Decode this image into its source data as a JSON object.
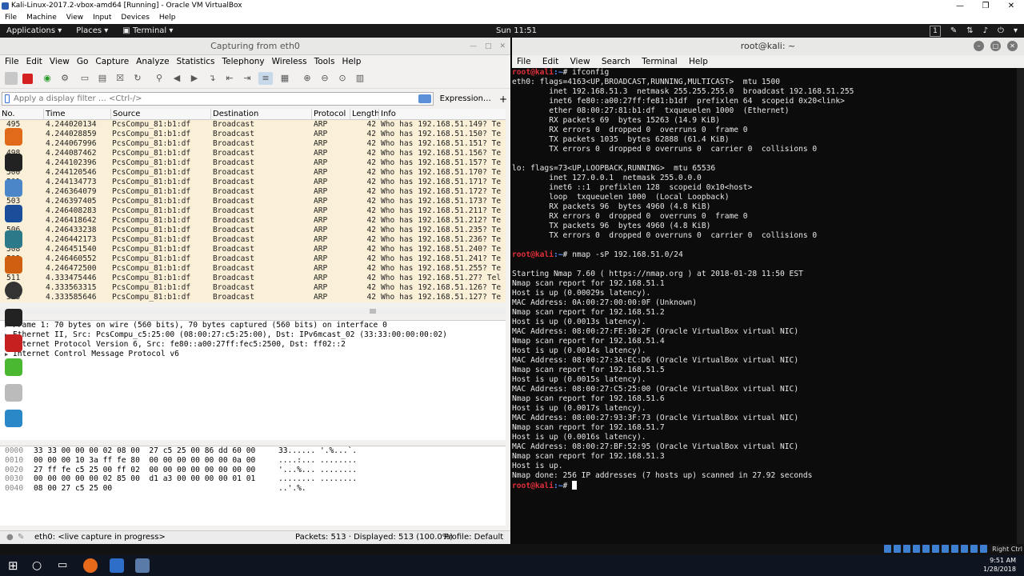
{
  "vbox": {
    "title": "Kali-Linux-2017.2-vbox-amd64 [Running] - Oracle VM VirtualBox",
    "menu": [
      "File",
      "Machine",
      "View",
      "Input",
      "Devices",
      "Help"
    ],
    "host_key": "Right Ctrl"
  },
  "panel": {
    "applications": "Applications",
    "places": "Places",
    "terminal": "Terminal",
    "clock": "Sun 11:51",
    "workspace": "1"
  },
  "ws": {
    "title": "Capturing from eth0",
    "menu": [
      "File",
      "Edit",
      "View",
      "Go",
      "Capture",
      "Analyze",
      "Statistics",
      "Telephony",
      "Wireless",
      "Tools",
      "Help"
    ],
    "filter_placeholder": "Apply a display filter … <Ctrl-/>",
    "expression": "Expression…",
    "plus": "+",
    "columns": [
      "No.",
      "Time",
      "Source",
      "Destination",
      "Protocol",
      "Length",
      "Info"
    ],
    "rows": [
      [
        "495",
        "4.244020134",
        "PcsCompu_81:b1:df",
        "Broadcast",
        "ARP",
        "42",
        "Who has 192.168.51.149? Te"
      ],
      [
        "496",
        "4.244028859",
        "PcsCompu_81:b1:df",
        "Broadcast",
        "ARP",
        "42",
        "Who has 192.168.51.150? Te"
      ],
      [
        "497",
        "4.244067996",
        "PcsCompu_81:b1:df",
        "Broadcast",
        "ARP",
        "42",
        "Who has 192.168.51.151? Te"
      ],
      [
        "498",
        "4.244087462",
        "PcsCompu_81:b1:df",
        "Broadcast",
        "ARP",
        "42",
        "Who has 192.168.51.156? Te"
      ],
      [
        "499",
        "4.244102396",
        "PcsCompu_81:b1:df",
        "Broadcast",
        "ARP",
        "42",
        "Who has 192.168.51.157? Te"
      ],
      [
        "500",
        "4.244120546",
        "PcsCompu_81:b1:df",
        "Broadcast",
        "ARP",
        "42",
        "Who has 192.168.51.170? Te"
      ],
      [
        "501",
        "4.244134773",
        "PcsCompu_81:b1:df",
        "Broadcast",
        "ARP",
        "42",
        "Who has 192.168.51.171? Te"
      ],
      [
        "502",
        "4.246364079",
        "PcsCompu_81:b1:df",
        "Broadcast",
        "ARP",
        "42",
        "Who has 192.168.51.172? Te"
      ],
      [
        "503",
        "4.246397405",
        "PcsCompu_81:b1:df",
        "Broadcast",
        "ARP",
        "42",
        "Who has 192.168.51.173? Te"
      ],
      [
        "504",
        "4.246408283",
        "PcsCompu_81:b1:df",
        "Broadcast",
        "ARP",
        "42",
        "Who has 192.168.51.211? Te"
      ],
      [
        "505",
        "4.246418642",
        "PcsCompu_81:b1:df",
        "Broadcast",
        "ARP",
        "42",
        "Who has 192.168.51.212? Te"
      ],
      [
        "506",
        "4.246433238",
        "PcsCompu_81:b1:df",
        "Broadcast",
        "ARP",
        "42",
        "Who has 192.168.51.235? Te"
      ],
      [
        "507",
        "4.246442173",
        "PcsCompu_81:b1:df",
        "Broadcast",
        "ARP",
        "42",
        "Who has 192.168.51.236? Te"
      ],
      [
        "508",
        "4.246451540",
        "PcsCompu_81:b1:df",
        "Broadcast",
        "ARP",
        "42",
        "Who has 192.168.51.240? Te"
      ],
      [
        "509",
        "4.246460552",
        "PcsCompu_81:b1:df",
        "Broadcast",
        "ARP",
        "42",
        "Who has 192.168.51.241? Te"
      ],
      [
        "510",
        "4.246472500",
        "PcsCompu_81:b1:df",
        "Broadcast",
        "ARP",
        "42",
        "Who has 192.168.51.255? Te"
      ],
      [
        "511",
        "4.333475446",
        "PcsCompu_81:b1:df",
        "Broadcast",
        "ARP",
        "42",
        "Who has 192.168.51.27? Tel"
      ],
      [
        "512",
        "4.333563315",
        "PcsCompu_81:b1:df",
        "Broadcast",
        "ARP",
        "42",
        "Who has 192.168.51.126? Te"
      ],
      [
        "513",
        "4.333585646",
        "PcsCompu_81:b1:df",
        "Broadcast",
        "ARP",
        "42",
        "Who has 192.168.51.127? Te"
      ]
    ],
    "details": [
      "Frame 1: 70 bytes on wire (560 bits), 70 bytes captured (560 bits) on interface 0",
      "Ethernet II, Src: PcsCompu_c5:25:00 (08:00:27:c5:25:00), Dst: IPv6mcast_02 (33:33:00:00:00:02)",
      "Internet Protocol Version 6, Src: fe80::a00:27ff:fec5:2500, Dst: ff02::2",
      "Internet Control Message Protocol v6"
    ],
    "bytes": [
      [
        "0000",
        "33 33 00 00 00 02 08 00  27 c5 25 00 86 dd 60 00",
        "33...... '.%...`."
      ],
      [
        "0010",
        "00 00 00 10 3a ff fe 80  00 00 00 00 00 00 0a 00",
        "....:... ........"
      ],
      [
        "0020",
        "27 ff fe c5 25 00 ff 02  00 00 00 00 00 00 00 00",
        "'...%... ........"
      ],
      [
        "0030",
        "00 00 00 00 00 02 85 00  d1 a3 00 00 00 00 01 01",
        "........ ........"
      ],
      [
        "0040",
        "08 00 27 c5 25 00",
        "..'.%."
      ]
    ],
    "status": {
      "iface": "eth0: <live capture in progress>",
      "packets": "Packets: 513 · Displayed: 513 (100.0%)",
      "profile": "Profile: Default"
    }
  },
  "term": {
    "title": "root@kali: ~",
    "menu": [
      "File",
      "Edit",
      "View",
      "Search",
      "Terminal",
      "Help"
    ],
    "prompt_user": "root@kali",
    "prompt_path": ":~",
    "prompt_sym": "#",
    "cmd1": " ifconfig",
    "ifconfig": [
      "eth0: flags=4163<UP,BROADCAST,RUNNING,MULTICAST>  mtu 1500",
      "        inet 192.168.51.3  netmask 255.255.255.0  broadcast 192.168.51.255",
      "        inet6 fe80::a00:27ff:fe81:b1df  prefixlen 64  scopeid 0x20<link>",
      "        ether 08:00:27:81:b1:df  txqueuelen 1000  (Ethernet)",
      "        RX packets 69  bytes 15263 (14.9 KiB)",
      "        RX errors 0  dropped 0  overruns 0  frame 0",
      "        TX packets 1035  bytes 62888 (61.4 KiB)",
      "        TX errors 0  dropped 0 overruns 0  carrier 0  collisions 0",
      "",
      "lo: flags=73<UP,LOOPBACK,RUNNING>  mtu 65536",
      "        inet 127.0.0.1  netmask 255.0.0.0",
      "        inet6 ::1  prefixlen 128  scopeid 0x10<host>",
      "        loop  txqueuelen 1000  (Local Loopback)",
      "        RX packets 96  bytes 4960 (4.8 KiB)",
      "        RX errors 0  dropped 0  overruns 0  frame 0",
      "        TX packets 96  bytes 4960 (4.8 KiB)",
      "        TX errors 0  dropped 0 overruns 0  carrier 0  collisions 0",
      ""
    ],
    "cmd2": " nmap -sP 192.168.51.0/24",
    "nmap": [
      "",
      "Starting Nmap 7.60 ( https://nmap.org ) at 2018-01-28 11:50 EST",
      "Nmap scan report for 192.168.51.1",
      "Host is up (0.00029s latency).",
      "MAC Address: 0A:00:27:00:00:0F (Unknown)",
      "Nmap scan report for 192.168.51.2",
      "Host is up (0.0013s latency).",
      "MAC Address: 08:00:27:FE:30:2F (Oracle VirtualBox virtual NIC)",
      "Nmap scan report for 192.168.51.4",
      "Host is up (0.0014s latency).",
      "MAC Address: 08:00:27:3A:EC:D6 (Oracle VirtualBox virtual NIC)",
      "Nmap scan report for 192.168.51.5",
      "Host is up (0.0015s latency).",
      "MAC Address: 08:00:27:C5:25:00 (Oracle VirtualBox virtual NIC)",
      "Nmap scan report for 192.168.51.6",
      "Host is up (0.0017s latency).",
      "MAC Address: 08:00:27:93:3F:73 (Oracle VirtualBox virtual NIC)",
      "Nmap scan report for 192.168.51.7",
      "Host is up (0.0016s latency).",
      "MAC Address: 08:00:27:BF:52:95 (Oracle VirtualBox virtual NIC)",
      "Nmap scan report for 192.168.51.3",
      "Host is up.",
      "Nmap done: 256 IP addresses (7 hosts up) scanned in 27.92 seconds"
    ]
  },
  "taskbar": {
    "time": "9:51 AM",
    "date": "1/28/2018"
  }
}
